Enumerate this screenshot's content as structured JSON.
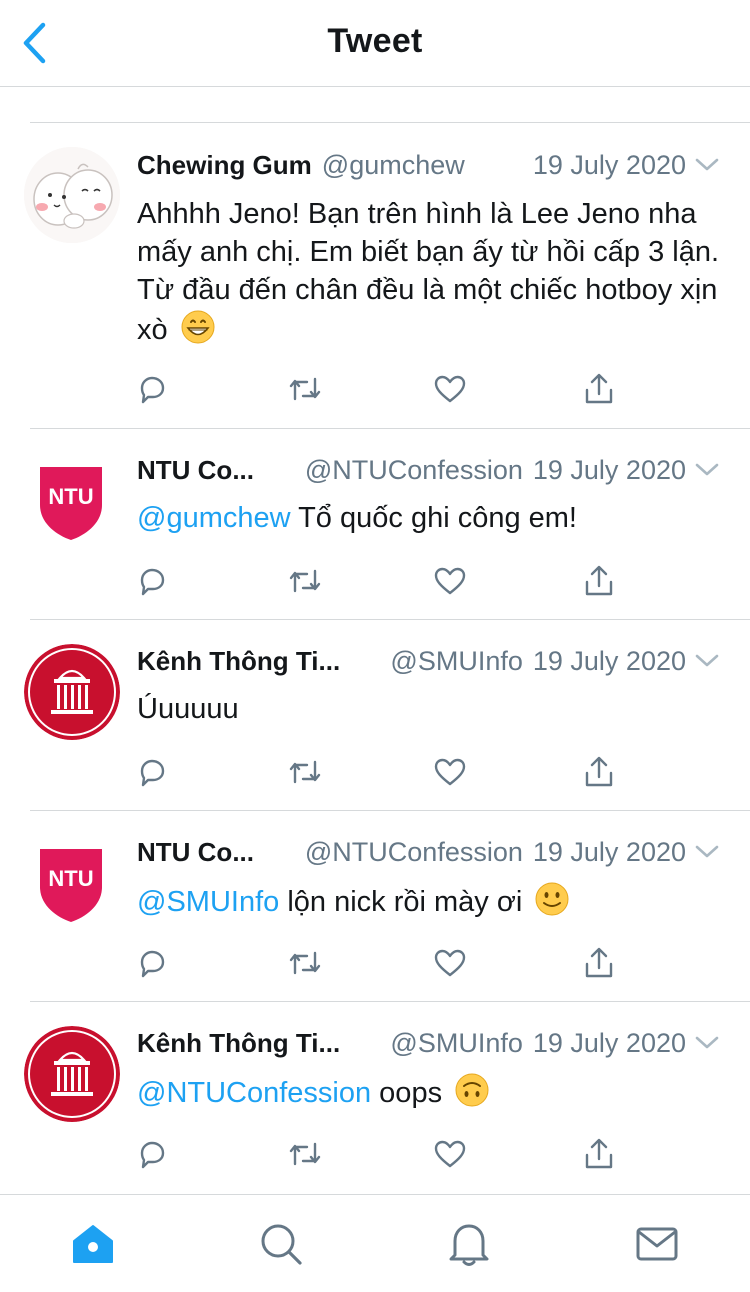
{
  "header": {
    "title": "Tweet"
  },
  "colors": {
    "accent": "#1da1f2",
    "muted": "#657786",
    "ntu": "#e0195a",
    "smu": "#c8102e"
  },
  "tweets": [
    {
      "name": "Chewing Gum",
      "handle": "@gumchew",
      "date": "19 July 2020",
      "avatar": "cartoon-hug-avatar",
      "text": "Ahhhh Jeno! Bạn trên hình là Lee Jeno nha mấy anh chị. Em biết bạn ấy từ hồi cấp 3 lận. Từ đầu đến chân đều là một chiếc hotboy xịn xò",
      "emoji": "grinning-face-emoji"
    },
    {
      "name": "NTU Co...",
      "handle": "@NTUConfession",
      "date": "19 July 2020",
      "avatar_text": "NTU",
      "mention": "@gumchew",
      "text": " Tổ quốc ghi công em!"
    },
    {
      "name": "Kênh Thông Ti...",
      "handle": "@SMUInfo",
      "date": "19 July 2020",
      "avatar": "smu-building-avatar",
      "text": "Úuuuuu"
    },
    {
      "name": "NTU Co...",
      "handle": "@NTUConfession",
      "date": "19 July 2020",
      "avatar_text": "NTU",
      "mention": "@SMUInfo",
      "text": " lộn nick rồi mày ơi",
      "emoji": "slightly-smiling-face-emoji"
    },
    {
      "name": "Kênh Thông Ti...",
      "handle": "@SMUInfo",
      "date": "19 July 2020",
      "avatar": "smu-building-avatar",
      "mention": "@NTUConfession",
      "text": " oops",
      "emoji": "upside-down-face-emoji"
    }
  ],
  "tabbar": [
    "home-icon",
    "search-icon",
    "notifications-icon",
    "messages-icon"
  ]
}
